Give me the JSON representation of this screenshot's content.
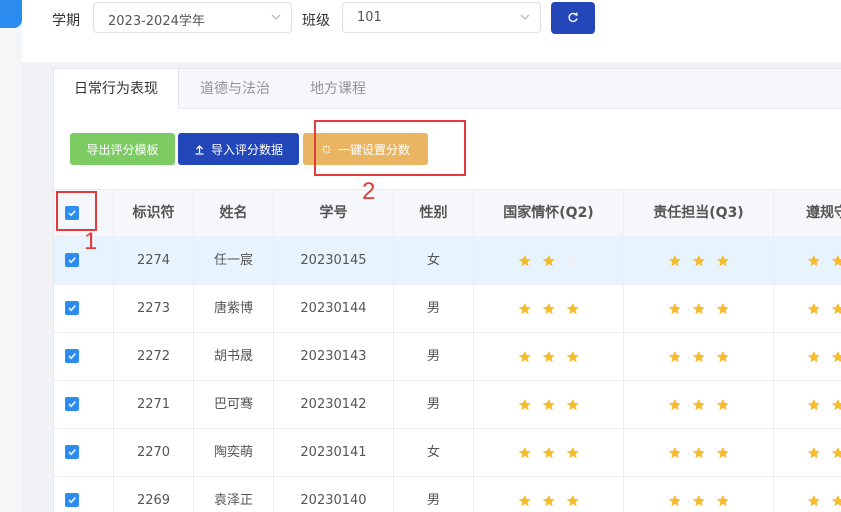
{
  "filters": {
    "term_label": "学期",
    "term_value": "2023-2024学年",
    "class_label": "班级",
    "class_value": "101"
  },
  "tabs": [
    {
      "label": "日常行为表现",
      "active": true
    },
    {
      "label": "道德与法治",
      "active": false
    },
    {
      "label": "地方课程",
      "active": false
    }
  ],
  "toolbar": {
    "export_label": "导出评分模板",
    "import_label": "导入评分数据",
    "set_label": "一键设置分数"
  },
  "annotations": {
    "one": "1",
    "two": "2"
  },
  "table": {
    "headers": [
      "标识符",
      "姓名",
      "学号",
      "性别",
      "国家情怀(Q2)",
      "责任担当(Q3)",
      "遵规守"
    ],
    "rows": [
      {
        "id": "2274",
        "name": "任一宸",
        "student_no": "20230145",
        "gender": "女",
        "q2": 2,
        "q3": 3,
        "q4": 2,
        "checked": true,
        "highlighted": true
      },
      {
        "id": "2273",
        "name": "唐紫博",
        "student_no": "20230144",
        "gender": "男",
        "q2": 3,
        "q3": 3,
        "q4": 2,
        "checked": true,
        "highlighted": false
      },
      {
        "id": "2272",
        "name": "胡书晟",
        "student_no": "20230143",
        "gender": "男",
        "q2": 3,
        "q3": 3,
        "q4": 2,
        "checked": true,
        "highlighted": false
      },
      {
        "id": "2271",
        "name": "巴可骞",
        "student_no": "20230142",
        "gender": "男",
        "q2": 3,
        "q3": 3,
        "q4": 2,
        "checked": true,
        "highlighted": false
      },
      {
        "id": "2270",
        "name": "陶奕萌",
        "student_no": "20230141",
        "gender": "女",
        "q2": 3,
        "q3": 3,
        "q4": 2,
        "checked": true,
        "highlighted": false
      },
      {
        "id": "2269",
        "name": "袁泽正",
        "student_no": "20230140",
        "gender": "男",
        "q2": 3,
        "q3": 3,
        "q4": 2,
        "checked": true,
        "highlighted": false
      }
    ]
  },
  "colors": {
    "primary": "#2346b8",
    "checkbox": "#2d8cf0",
    "star_on": "#f7ba2a",
    "star_off": "#eef0f3",
    "annotation": "#e23b3b"
  }
}
